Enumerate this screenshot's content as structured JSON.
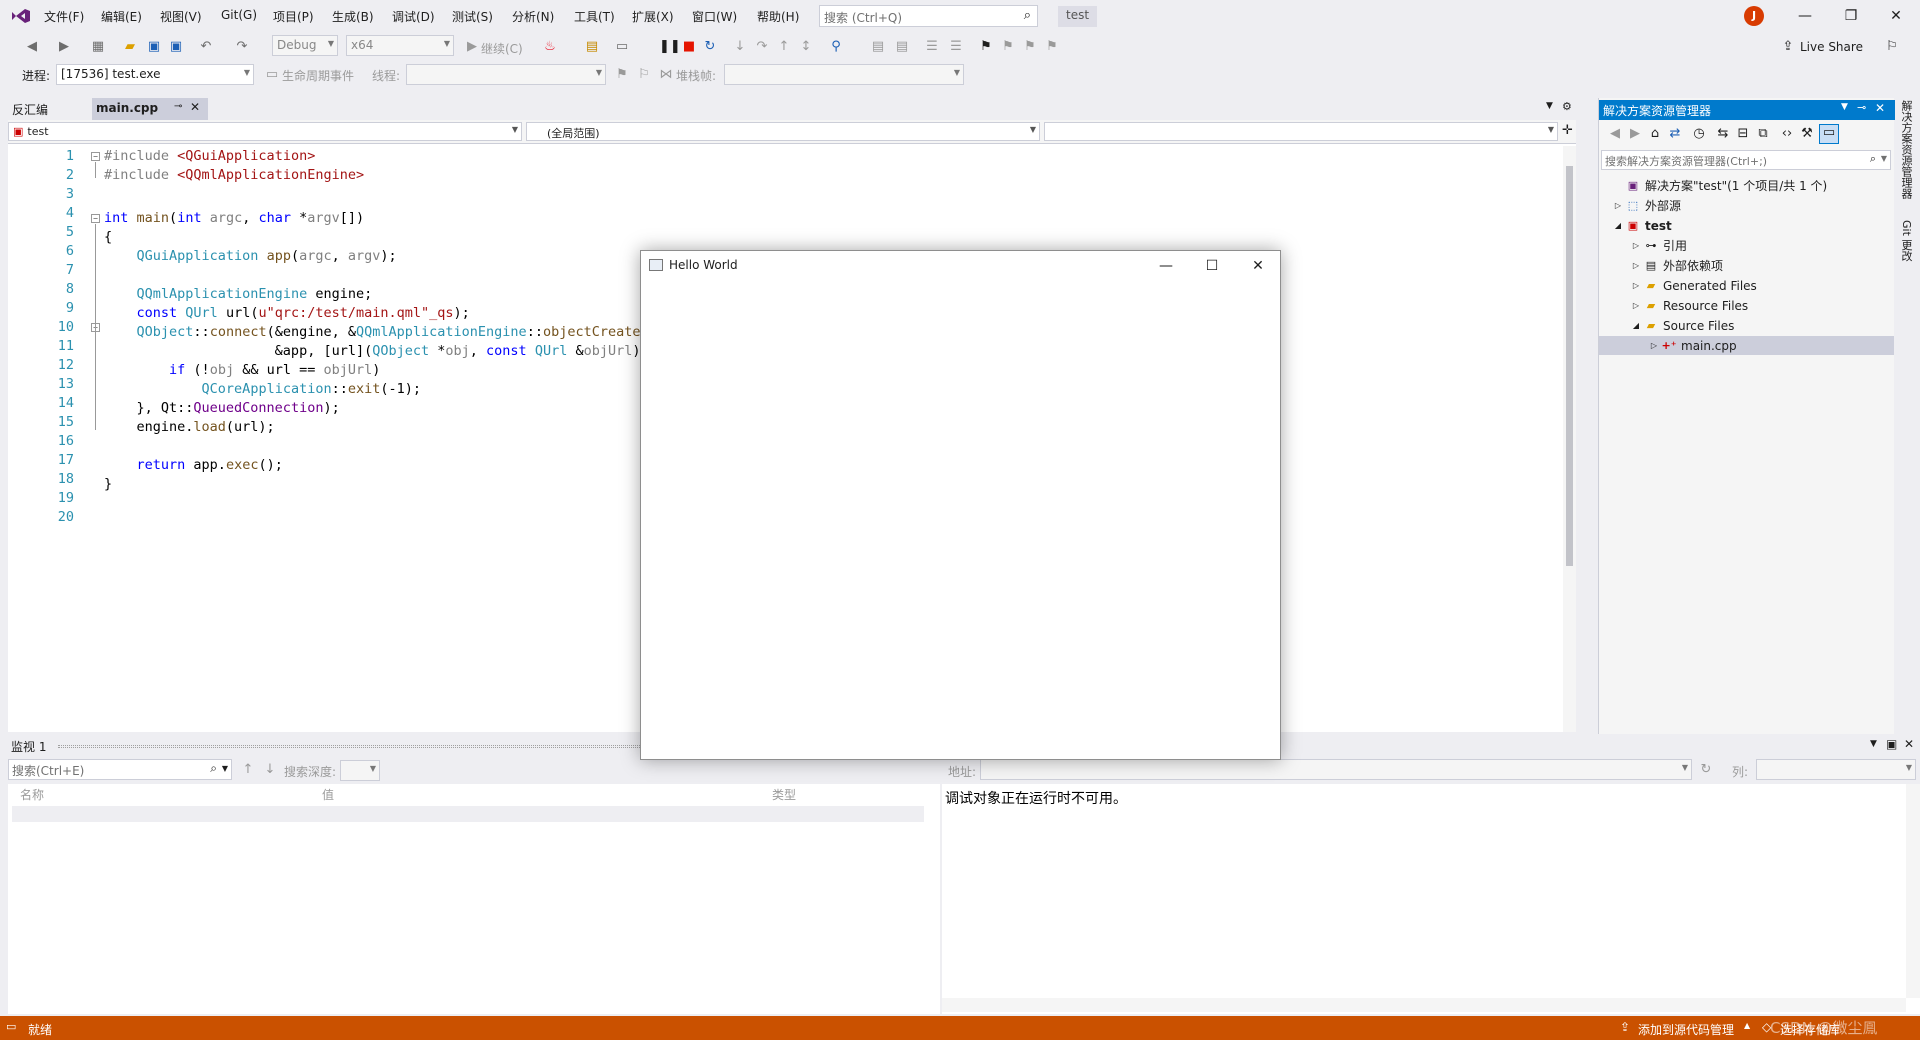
{
  "menubar": {
    "items": [
      "文件(F)",
      "编辑(E)",
      "视图(V)",
      "Git(G)",
      "项目(P)",
      "生成(B)",
      "调试(D)",
      "测试(S)",
      "分析(N)",
      "工具(T)",
      "扩展(X)",
      "窗口(W)",
      "帮助(H)"
    ],
    "search_placeholder": "搜索 (Ctrl+Q)",
    "solution_badge": "test",
    "avatar_initial": "J",
    "live_share": "Live Share"
  },
  "toolbar": {
    "config": "Debug",
    "platform": "x64",
    "continue_label": "继续(C)",
    "process_label": "进程:",
    "process_value": "[17536] test.exe",
    "lifecycle_label": "生命周期事件",
    "thread_label": "线程:",
    "stackframe_label": "堆栈帧:"
  },
  "doc_tabs": [
    {
      "label": "反汇编",
      "active": false
    },
    {
      "label": "main.cpp",
      "active": true
    }
  ],
  "nav_bar": {
    "project": "test",
    "scope": "(全局范围)",
    "member": ""
  },
  "code": {
    "line_numbers": [
      "1",
      "2",
      "3",
      "4",
      "5",
      "6",
      "7",
      "8",
      "9",
      "10",
      "11",
      "12",
      "13",
      "14",
      "15",
      "16",
      "17",
      "18",
      "19",
      "20"
    ]
  },
  "solution_explorer": {
    "title": "解决方案资源管理器",
    "search_placeholder": "搜索解决方案资源管理器(Ctrl+;)",
    "solution": "解决方案\"test\"(1 个项目/共 1 个)",
    "external_sources": "外部源",
    "project": "test",
    "references": "引用",
    "external_deps": "外部依赖项",
    "generated_files": "Generated Files",
    "resource_files": "Resource Files",
    "source_files": "Source Files",
    "main_cpp": "main.cpp"
  },
  "side_tabs": [
    "解决方案资源管理器",
    "Git 更改"
  ],
  "watch_panel": {
    "title": "监视 1",
    "search_placeholder": "搜索(Ctrl+E)",
    "search_depth_label": "搜索深度:",
    "col_name": "名称",
    "col_value": "值",
    "col_type": "类型"
  },
  "memory_panel": {
    "address_label": "地址:",
    "columns_label": "列:",
    "message": "调试对象正在运行时不可用。"
  },
  "statusbar": {
    "ready": "就绪",
    "add_source_control": "添加到源代码管理",
    "select_repo": "选择存储库",
    "watermark": "CSDN @微尘鳯"
  },
  "hello_window": {
    "title": "Hello World"
  },
  "colors": {
    "accent": "#007acc",
    "statusbar": "#ca5100",
    "avatar": "#d83b01"
  }
}
